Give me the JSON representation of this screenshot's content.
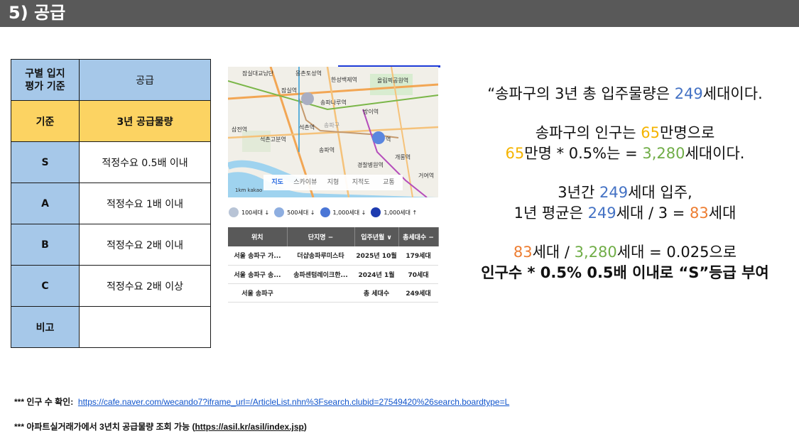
{
  "header": {
    "title": "5) 공급"
  },
  "criteria_table": {
    "header_left": "구별 입지\n평가 기준",
    "header_right": "공급",
    "rows": [
      {
        "grade": "기준",
        "value": "3년 공급물량"
      },
      {
        "grade": "S",
        "value": "적정수요 0.5배 이내"
      },
      {
        "grade": "A",
        "value": "적정수요 1배 이내"
      },
      {
        "grade": "B",
        "value": "적정수요 2배 이내"
      },
      {
        "grade": "C",
        "value": "적정수요 2배 이상"
      },
      {
        "grade": "비고",
        "value": ""
      }
    ]
  },
  "map": {
    "labels": {
      "jamsil_bridge": "잠실대교남단",
      "nongong": "몽촌토성역",
      "hanseong": "한성백제역",
      "olympic": "올림픽공원역",
      "jamsil": "잠실역",
      "songpa_naru": "송파나루역",
      "bangi": "방이역",
      "samjeon": "삼전역",
      "seokchon_gobun": "석촌고분역",
      "seokchon": "석촌역",
      "songpa_gu": "송파구",
      "ogeum_station": "역",
      "songpa": "송파역",
      "gaerong": "개롱역",
      "police": "경찰병원역",
      "geoyeo": "거여역"
    },
    "tabs": [
      "지도",
      "스카이뷰",
      "지형",
      "지적도",
      "교통"
    ],
    "scale": "1km  kakao"
  },
  "legend": [
    "100세대 ↓",
    "500세대 ↓",
    "1,000세대 ↓",
    "1,000세대 ↑"
  ],
  "complex_table": {
    "headers": [
      "위치",
      "단지명 −",
      "입주년월 ∨",
      "총세대수 −"
    ],
    "rows": [
      [
        "서울 송파구 가...",
        "더샵송파루미스타",
        "2025년 10월",
        "179세대"
      ],
      [
        "서울 송파구 송...",
        "송파센텀레이크한...",
        "2024년 1월",
        "70세대"
      ],
      [
        "서울 송파구",
        "",
        "총 세대수",
        "249세대"
      ]
    ]
  },
  "analysis": {
    "l1a": "“송파구의 3년 총 입주물량은 ",
    "l1n": "249",
    "l1b": "세대이다.",
    "l2a": "송파구의 인구는 ",
    "l2n": "65",
    "l2b": "만명으로",
    "l3n1": "65",
    "l3a": "만명 * 0.5%는 = ",
    "l3n2": "3,280",
    "l3b": "세대이다.",
    "l4a": "3년간 ",
    "l4n": "249",
    "l4b": "세대 입주,",
    "l5a": "1년 평균은 ",
    "l5n1": "249",
    "l5b": "세대 / 3 = ",
    "l5n2": "83",
    "l5c": "세대",
    "l6n1": "83",
    "l6a": "세대 / ",
    "l6n2": "3,280",
    "l6b": "세대 = 0.025으로",
    "l7": "인구수 * 0.5% 0.5배 이내로 “S”등급 부여"
  },
  "footnotes": {
    "f1_label": "*** 인구 수 확인:",
    "f1_url": "https://cafe.naver.com/wecando7?iframe_url=/ArticleList.nhn%3Fsearch.clubid=27549420%26search.boardtype=L",
    "f2_label": "*** 아파트실거래가에서 3년치 공급물량 조회 가능 (",
    "f2_url": "https://asil.kr/asil/index.jsp",
    "f2_end": ")"
  }
}
